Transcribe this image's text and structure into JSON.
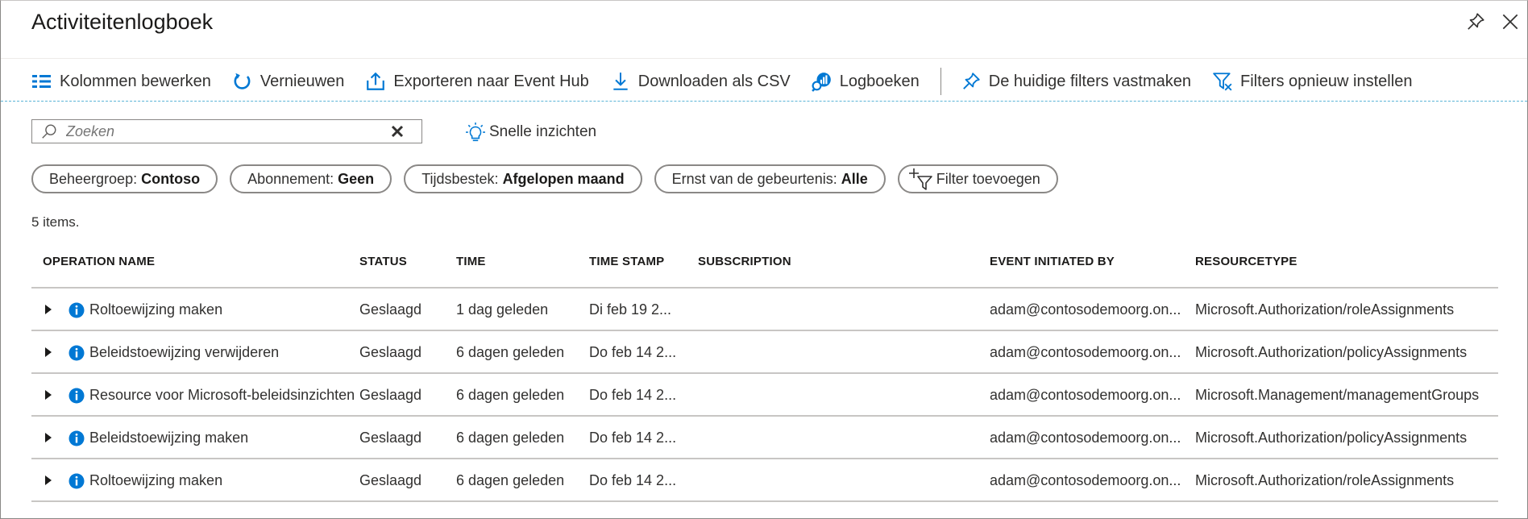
{
  "blade": {
    "title": "Activiteitenlogboek"
  },
  "toolbar": {
    "items": [
      {
        "label": "Kolommen bewerken",
        "icon": "edit-columns-icon"
      },
      {
        "label": "Vernieuwen",
        "icon": "refresh-icon"
      },
      {
        "label": "Exporteren naar Event Hub",
        "icon": "export-icon"
      },
      {
        "label": "Downloaden als CSV",
        "icon": "download-icon"
      },
      {
        "label": "Logboeken",
        "icon": "logs-icon"
      },
      {
        "label": "De huidige filters vastmaken",
        "icon": "pin-icon"
      },
      {
        "label": "Filters opnieuw instellen",
        "icon": "filter-reset-icon"
      }
    ]
  },
  "search": {
    "placeholder": "Zoeken",
    "value": ""
  },
  "insights": {
    "label": "Snelle inzichten"
  },
  "filters": [
    {
      "key": "Beheergroep:",
      "value": "Contoso"
    },
    {
      "key": "Abonnement:",
      "value": "Geen"
    },
    {
      "key": "Tijdsbestek:",
      "value": "Afgelopen maand"
    },
    {
      "key": "Ernst van de gebeurtenis:",
      "value": "Alle"
    }
  ],
  "add_filter": {
    "label": "Filter toevoegen"
  },
  "count_label": "5 items.",
  "table": {
    "columns": [
      "OPERATION NAME",
      "STATUS",
      "TIME",
      "TIME STAMP",
      "SUBSCRIPTION",
      "EVENT INITIATED BY",
      "RESOURCETYPE"
    ],
    "rows": [
      [
        "Roltoewijzing maken",
        "Geslaagd",
        "1 dag geleden",
        "Di feb 19 2...",
        "",
        "adam@contosodemoorg.on...",
        "Microsoft.Authorization/roleAssignments"
      ],
      [
        "Beleidstoewijzing verwijderen",
        "Geslaagd",
        "6 dagen geleden",
        "Do feb 14 2...",
        "",
        "adam@contosodemoorg.on...",
        "Microsoft.Authorization/policyAssignments"
      ],
      [
        "Resource voor Microsoft-beleidsinzichten",
        "Geslaagd",
        "6 dagen geleden",
        "Do feb 14 2...",
        "",
        "adam@contosodemoorg.on...",
        "Microsoft.Management/managementGroups"
      ],
      [
        "Beleidstoewijzing maken",
        "Geslaagd",
        "6 dagen geleden",
        "Do feb 14 2...",
        "",
        "adam@contosodemoorg.on...",
        "Microsoft.Authorization/policyAssignments"
      ],
      [
        "Roltoewijzing maken",
        "Geslaagd",
        "6 dagen geleden",
        "Do feb 14 2...",
        "",
        "adam@contosodemoorg.on...",
        "Microsoft.Authorization/roleAssignments"
      ]
    ]
  },
  "colors": {
    "accent": "#0078d4",
    "separator_dashed": "#5ab4d6",
    "border": "#8a8886"
  }
}
